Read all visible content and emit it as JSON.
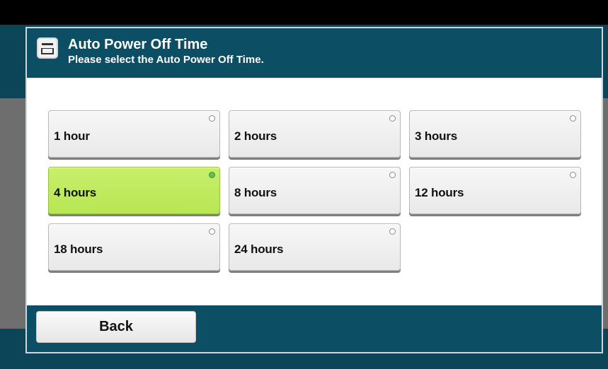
{
  "dialog": {
    "title": "Auto Power Off Time",
    "subtitle": "Please select the Auto Power Off Time.",
    "icon": "panel-icon"
  },
  "options": [
    {
      "label": "1 hour",
      "selected": false
    },
    {
      "label": "2 hours",
      "selected": false
    },
    {
      "label": "3 hours",
      "selected": false
    },
    {
      "label": "4 hours",
      "selected": true
    },
    {
      "label": "8 hours",
      "selected": false
    },
    {
      "label": "12 hours",
      "selected": false
    },
    {
      "label": "18 hours",
      "selected": false
    },
    {
      "label": "24 hours",
      "selected": false
    }
  ],
  "footer": {
    "back_label": "Back"
  },
  "colors": {
    "header": "#0c4f65",
    "selected": "#bde95c",
    "button": "#eeeeee"
  }
}
